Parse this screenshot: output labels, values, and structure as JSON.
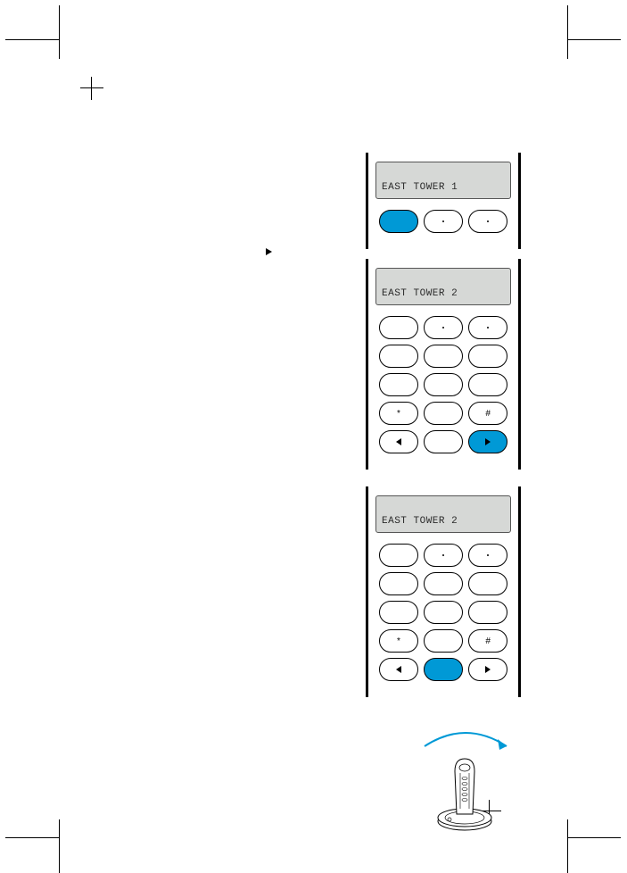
{
  "block1": {
    "lcd": "EAST TOWER 1"
  },
  "block2": {
    "lcd": "EAST TOWER 2"
  },
  "block3": {
    "lcd": "EAST TOWER 2"
  }
}
